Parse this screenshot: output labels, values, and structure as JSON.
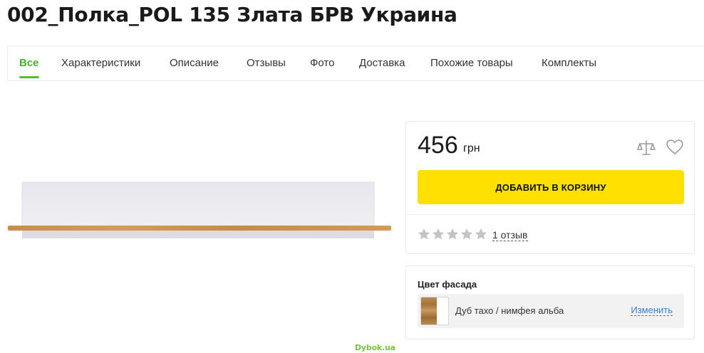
{
  "product": {
    "title": "002_Полка_POL 135 Злата БРВ Украина"
  },
  "tabs": [
    {
      "label": "Все",
      "active": true
    },
    {
      "label": "Характеристики",
      "active": false
    },
    {
      "label": "Описание",
      "active": false
    },
    {
      "label": "Отзывы",
      "active": false
    },
    {
      "label": "Фото",
      "active": false
    },
    {
      "label": "Доставка",
      "active": false
    },
    {
      "label": "Похожие товары",
      "active": false
    },
    {
      "label": "Комплекты",
      "active": false
    }
  ],
  "image": {
    "watermark": "Dybok.ua"
  },
  "price_card": {
    "price": "456",
    "currency": "грн",
    "compare_icon": "scales-icon",
    "wishlist_icon": "heart-icon",
    "add_to_cart_label": "ДОБАВИТЬ В КОРЗИНУ",
    "rating": {
      "value": 0,
      "max": 5
    },
    "reviews_label": "1 отзыв"
  },
  "facade_color": {
    "title": "Цвет фасада",
    "selected": "Дуб тахо / нимфея альба",
    "change_label": "Изменить"
  },
  "colors": {
    "accent_green": "#5bbd2b",
    "cart_button": "#ffe000",
    "link_blue": "#3a7ec9",
    "star_gray": "#c4c4c4"
  }
}
